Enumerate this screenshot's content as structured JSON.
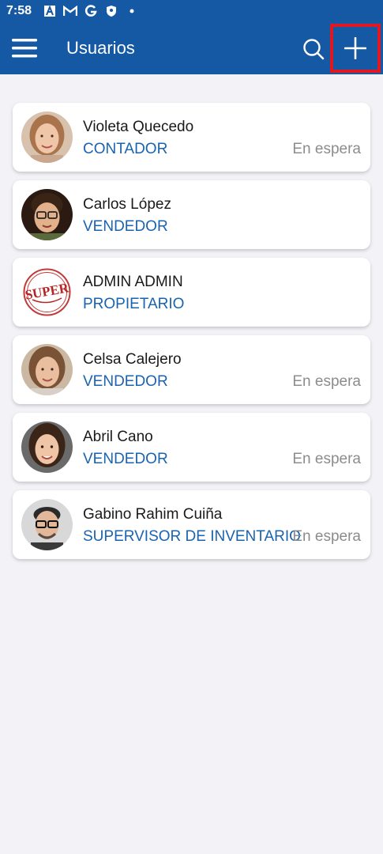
{
  "status_bar": {
    "time": "7:58",
    "icons": [
      "a-box-icon",
      "gmail-icon",
      "google-icon",
      "shield-icon",
      "dot-icon"
    ]
  },
  "app_bar": {
    "title": "Usuarios",
    "menu_icon": "hamburger-icon",
    "search_icon": "search-icon",
    "add_icon": "plus-icon"
  },
  "colors": {
    "primary": "#1558a4",
    "role_text": "#1a63b0",
    "status_text": "#8c8c8c",
    "highlight": "#e0181f",
    "background": "#f2f2f7"
  },
  "users": [
    {
      "name": "Violeta Quecedo",
      "role": "CONTADOR",
      "status": "En espera",
      "avatar": "woman-photo"
    },
    {
      "name": "Carlos López",
      "role": "VENDEDOR",
      "status": "",
      "avatar": "man-glasses-photo"
    },
    {
      "name": "ADMIN ADMIN",
      "role": "PROPIETARIO",
      "status": "",
      "avatar": "super-logo"
    },
    {
      "name": "Celsa Calejero",
      "role": "VENDEDOR",
      "status": "En espera",
      "avatar": "woman-photo"
    },
    {
      "name": "Abril Cano",
      "role": "VENDEDOR",
      "status": "En espera",
      "avatar": "woman-photo"
    },
    {
      "name": "Gabino Rahim Cuiña",
      "role": "SUPERVISOR DE INVENTARIO",
      "status": "En espera",
      "avatar": "man-glasses-photo"
    }
  ],
  "logo_text": "SUPER"
}
